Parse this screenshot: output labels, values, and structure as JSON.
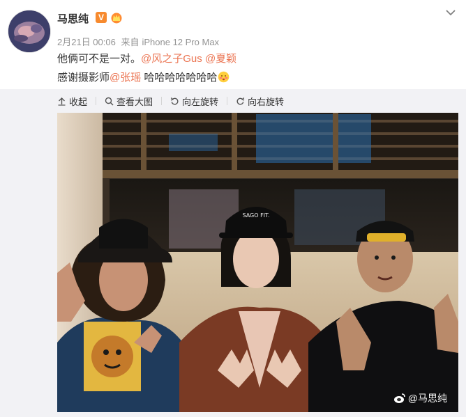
{
  "post": {
    "username": "马思纯",
    "verified_badge": "V",
    "timestamp": "2月21日 00:06",
    "source_prefix": "来自",
    "source": "iPhone 12 Pro Max",
    "line1_text": "他俩可不是一对。",
    "line1_mention1": "@风之子Gus",
    "line1_mention2": "@夏颖",
    "line2_text1": "感谢摄影师",
    "line2_mention": "@张瑶",
    "line2_text2": " 哈哈哈哈哈哈哈",
    "accent_color": "#eb7350"
  },
  "toolbar": {
    "collapse": "收起",
    "view_large": "查看大图",
    "rotate_left": "向左旋转",
    "rotate_right": "向右旋转"
  },
  "photo": {
    "watermark": "@马思纯",
    "cap_text": "SAGO FIT."
  },
  "icons": [
    "chevron-down-icon",
    "crown-icon",
    "collapse-icon",
    "magnify-icon",
    "rotate-left-icon",
    "rotate-right-icon",
    "weibo-icon",
    "blush-emoji-icon"
  ]
}
